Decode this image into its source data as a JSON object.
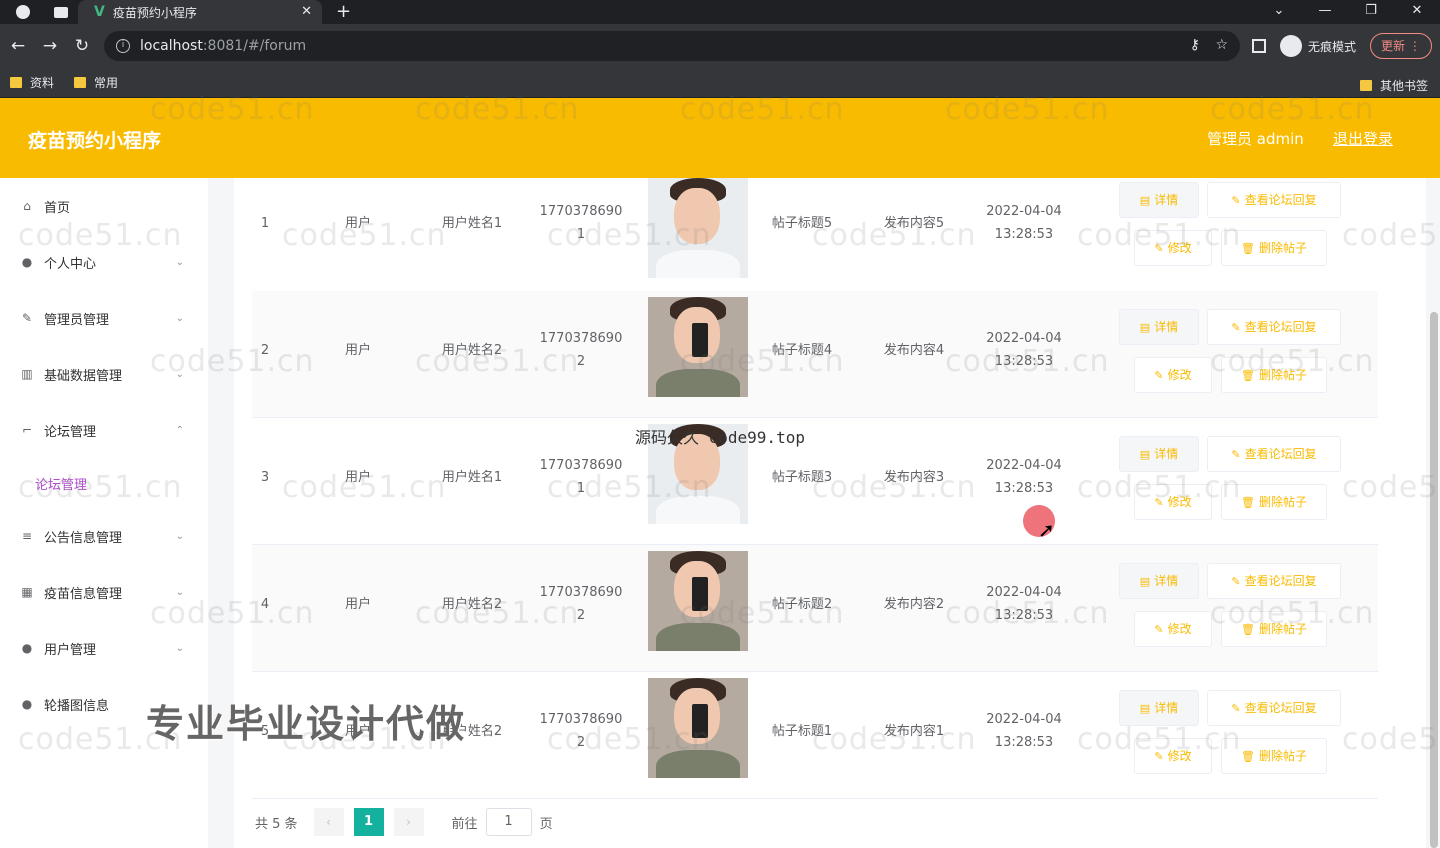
{
  "browser": {
    "tab_title": "疫苗预约小程序",
    "tab_logo": "V",
    "url_host": "localhost",
    "url_path": ":8081/#/forum",
    "incognito_label": "无痕模式",
    "update_label": "更新",
    "bookmarks": [
      "资料",
      "常用"
    ],
    "other_bookmarks": "其他书签"
  },
  "header": {
    "title": "疫苗预约小程序",
    "user": "管理员 admin",
    "logout": "退出登录"
  },
  "sidebar": {
    "items": [
      {
        "label": "首页",
        "icon": "home-icon"
      },
      {
        "label": "个人中心",
        "icon": "user-icon"
      },
      {
        "label": "管理员管理",
        "icon": "edit-icon"
      },
      {
        "label": "基础数据管理",
        "icon": "chart-icon"
      },
      {
        "label": "论坛管理",
        "icon": "crop-icon"
      },
      {
        "label": "公告信息管理",
        "icon": "list-icon"
      },
      {
        "label": "疫苗信息管理",
        "icon": "grid-icon"
      },
      {
        "label": "用户管理",
        "icon": "user-icon"
      },
      {
        "label": "轮播图信息",
        "icon": "user-icon"
      }
    ],
    "active_submenu": "论坛管理"
  },
  "table": {
    "rows": [
      {
        "idx": "1",
        "type": "用户",
        "name": "用户姓名1",
        "phone1": "1770378690",
        "phone2": "1",
        "title": "帖子标题5",
        "content": "发布内容5",
        "date": "2022-04-04",
        "time": "13:28:53"
      },
      {
        "idx": "2",
        "type": "用户",
        "name": "用户姓名2",
        "phone1": "1770378690",
        "phone2": "2",
        "title": "帖子标题4",
        "content": "发布内容4",
        "date": "2022-04-04",
        "time": "13:28:53"
      },
      {
        "idx": "3",
        "type": "用户",
        "name": "用户姓名1",
        "phone1": "1770378690",
        "phone2": "1",
        "title": "帖子标题3",
        "content": "发布内容3",
        "date": "2022-04-04",
        "time": "13:28:53"
      },
      {
        "idx": "4",
        "type": "用户",
        "name": "用户姓名2",
        "phone1": "1770378690",
        "phone2": "2",
        "title": "帖子标题2",
        "content": "发布内容2",
        "date": "2022-04-04",
        "time": "13:28:53"
      },
      {
        "idx": "5",
        "type": "用户",
        "name": "用户姓名2",
        "phone1": "1770378690",
        "phone2": "2",
        "title": "帖子标题1",
        "content": "发布内容1",
        "date": "2022-04-04",
        "time": "13:28:53"
      }
    ],
    "buttons": {
      "detail": "详情",
      "reply": "查看论坛回复",
      "edit": "修改",
      "delete": "删除帖子"
    }
  },
  "pagination": {
    "total": "共 5 条",
    "current": "1",
    "goto": "前往",
    "goto_value": "1",
    "page_suffix": "页"
  },
  "overlays": {
    "source_text": "源码久久 code99.top",
    "promo_text": "专业毕业设计代做",
    "watermark": "code51.cn"
  },
  "colors": {
    "header": "#f9bb00",
    "accent_button": "#f9bb00",
    "pager_active": "#14b19f",
    "submenu_active": "#b24fd1"
  }
}
